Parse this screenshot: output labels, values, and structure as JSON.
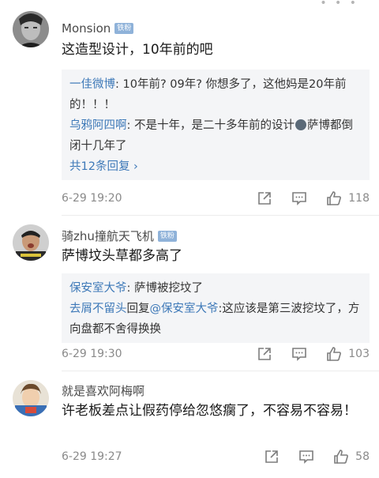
{
  "comments": [
    {
      "username": "Monsion",
      "badge": "铁粉",
      "text": "这造型设计，10年前的吧",
      "replies": [
        {
          "name": "一佳微博",
          "text": ": 10年前? 09年? 你想多了，这他妈是20年前的！！！"
        },
        {
          "name": "乌鸦阿四啊",
          "text_a": ": 不是十年，是二十多年前的设计",
          "text_b": "萨博都倒闭十几年了"
        }
      ],
      "more": "共12条回复 ›",
      "time": "6-29 19:20",
      "likes": "118"
    },
    {
      "username": "骑zhu撞航天飞机",
      "badge": "铁粉",
      "text": "萨博坟头草都多高了",
      "replies": [
        {
          "name": "保安室大爷",
          "text": ": 萨博被挖坟了"
        },
        {
          "name": "去屑不留头",
          "mid": "回复",
          "name2": "@保安室大爷",
          "text": ":这应该是第三波挖坟了，方向盘都不舍得换换"
        }
      ],
      "time": "6-29 19:30",
      "likes": "103"
    },
    {
      "username": "就是喜欢阿梅啊",
      "text": "许老板差点让假药停给忽悠瘸了，不容易不容易！",
      "time": "6-29 19:27",
      "likes": "58"
    }
  ],
  "icons": {
    "share": "share-icon",
    "comment": "comment-icon",
    "like": "thumbs-up-icon"
  },
  "colors": {
    "link": "#3e79b8",
    "badge": "#8fb2d9",
    "meta": "#8a8a8a",
    "reply_bg": "#f4f5f7"
  }
}
